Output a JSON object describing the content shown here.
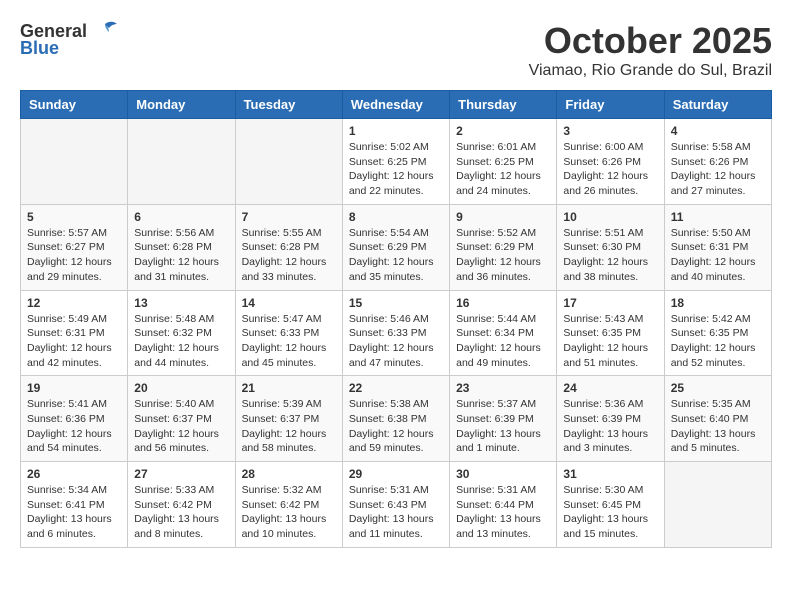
{
  "header": {
    "logo_general": "General",
    "logo_blue": "Blue",
    "month_title": "October 2025",
    "location": "Viamao, Rio Grande do Sul, Brazil"
  },
  "days_of_week": [
    "Sunday",
    "Monday",
    "Tuesday",
    "Wednesday",
    "Thursday",
    "Friday",
    "Saturday"
  ],
  "weeks": [
    [
      {
        "day": "",
        "empty": true
      },
      {
        "day": "",
        "empty": true
      },
      {
        "day": "",
        "empty": true
      },
      {
        "day": "1",
        "sunrise": "5:02 AM",
        "sunset": "6:25 PM",
        "daylight": "12 hours and 22 minutes."
      },
      {
        "day": "2",
        "sunrise": "6:01 AM",
        "sunset": "6:25 PM",
        "daylight": "12 hours and 24 minutes."
      },
      {
        "day": "3",
        "sunrise": "6:00 AM",
        "sunset": "6:26 PM",
        "daylight": "12 hours and 26 minutes."
      },
      {
        "day": "4",
        "sunrise": "5:58 AM",
        "sunset": "6:26 PM",
        "daylight": "12 hours and 27 minutes."
      }
    ],
    [
      {
        "day": "5",
        "sunrise": "5:57 AM",
        "sunset": "6:27 PM",
        "daylight": "12 hours and 29 minutes."
      },
      {
        "day": "6",
        "sunrise": "5:56 AM",
        "sunset": "6:28 PM",
        "daylight": "12 hours and 31 minutes."
      },
      {
        "day": "7",
        "sunrise": "5:55 AM",
        "sunset": "6:28 PM",
        "daylight": "12 hours and 33 minutes."
      },
      {
        "day": "8",
        "sunrise": "5:54 AM",
        "sunset": "6:29 PM",
        "daylight": "12 hours and 35 minutes."
      },
      {
        "day": "9",
        "sunrise": "5:52 AM",
        "sunset": "6:29 PM",
        "daylight": "12 hours and 36 minutes."
      },
      {
        "day": "10",
        "sunrise": "5:51 AM",
        "sunset": "6:30 PM",
        "daylight": "12 hours and 38 minutes."
      },
      {
        "day": "11",
        "sunrise": "5:50 AM",
        "sunset": "6:31 PM",
        "daylight": "12 hours and 40 minutes."
      }
    ],
    [
      {
        "day": "12",
        "sunrise": "5:49 AM",
        "sunset": "6:31 PM",
        "daylight": "12 hours and 42 minutes."
      },
      {
        "day": "13",
        "sunrise": "5:48 AM",
        "sunset": "6:32 PM",
        "daylight": "12 hours and 44 minutes."
      },
      {
        "day": "14",
        "sunrise": "5:47 AM",
        "sunset": "6:33 PM",
        "daylight": "12 hours and 45 minutes."
      },
      {
        "day": "15",
        "sunrise": "5:46 AM",
        "sunset": "6:33 PM",
        "daylight": "12 hours and 47 minutes."
      },
      {
        "day": "16",
        "sunrise": "5:44 AM",
        "sunset": "6:34 PM",
        "daylight": "12 hours and 49 minutes."
      },
      {
        "day": "17",
        "sunrise": "5:43 AM",
        "sunset": "6:35 PM",
        "daylight": "12 hours and 51 minutes."
      },
      {
        "day": "18",
        "sunrise": "5:42 AM",
        "sunset": "6:35 PM",
        "daylight": "12 hours and 52 minutes."
      }
    ],
    [
      {
        "day": "19",
        "sunrise": "5:41 AM",
        "sunset": "6:36 PM",
        "daylight": "12 hours and 54 minutes."
      },
      {
        "day": "20",
        "sunrise": "5:40 AM",
        "sunset": "6:37 PM",
        "daylight": "12 hours and 56 minutes."
      },
      {
        "day": "21",
        "sunrise": "5:39 AM",
        "sunset": "6:37 PM",
        "daylight": "12 hours and 58 minutes."
      },
      {
        "day": "22",
        "sunrise": "5:38 AM",
        "sunset": "6:38 PM",
        "daylight": "12 hours and 59 minutes."
      },
      {
        "day": "23",
        "sunrise": "5:37 AM",
        "sunset": "6:39 PM",
        "daylight": "13 hours and 1 minute."
      },
      {
        "day": "24",
        "sunrise": "5:36 AM",
        "sunset": "6:39 PM",
        "daylight": "13 hours and 3 minutes."
      },
      {
        "day": "25",
        "sunrise": "5:35 AM",
        "sunset": "6:40 PM",
        "daylight": "13 hours and 5 minutes."
      }
    ],
    [
      {
        "day": "26",
        "sunrise": "5:34 AM",
        "sunset": "6:41 PM",
        "daylight": "13 hours and 6 minutes."
      },
      {
        "day": "27",
        "sunrise": "5:33 AM",
        "sunset": "6:42 PM",
        "daylight": "13 hours and 8 minutes."
      },
      {
        "day": "28",
        "sunrise": "5:32 AM",
        "sunset": "6:42 PM",
        "daylight": "13 hours and 10 minutes."
      },
      {
        "day": "29",
        "sunrise": "5:31 AM",
        "sunset": "6:43 PM",
        "daylight": "13 hours and 11 minutes."
      },
      {
        "day": "30",
        "sunrise": "5:31 AM",
        "sunset": "6:44 PM",
        "daylight": "13 hours and 13 minutes."
      },
      {
        "day": "31",
        "sunrise": "5:30 AM",
        "sunset": "6:45 PM",
        "daylight": "13 hours and 15 minutes."
      },
      {
        "day": "",
        "empty": true
      }
    ]
  ]
}
